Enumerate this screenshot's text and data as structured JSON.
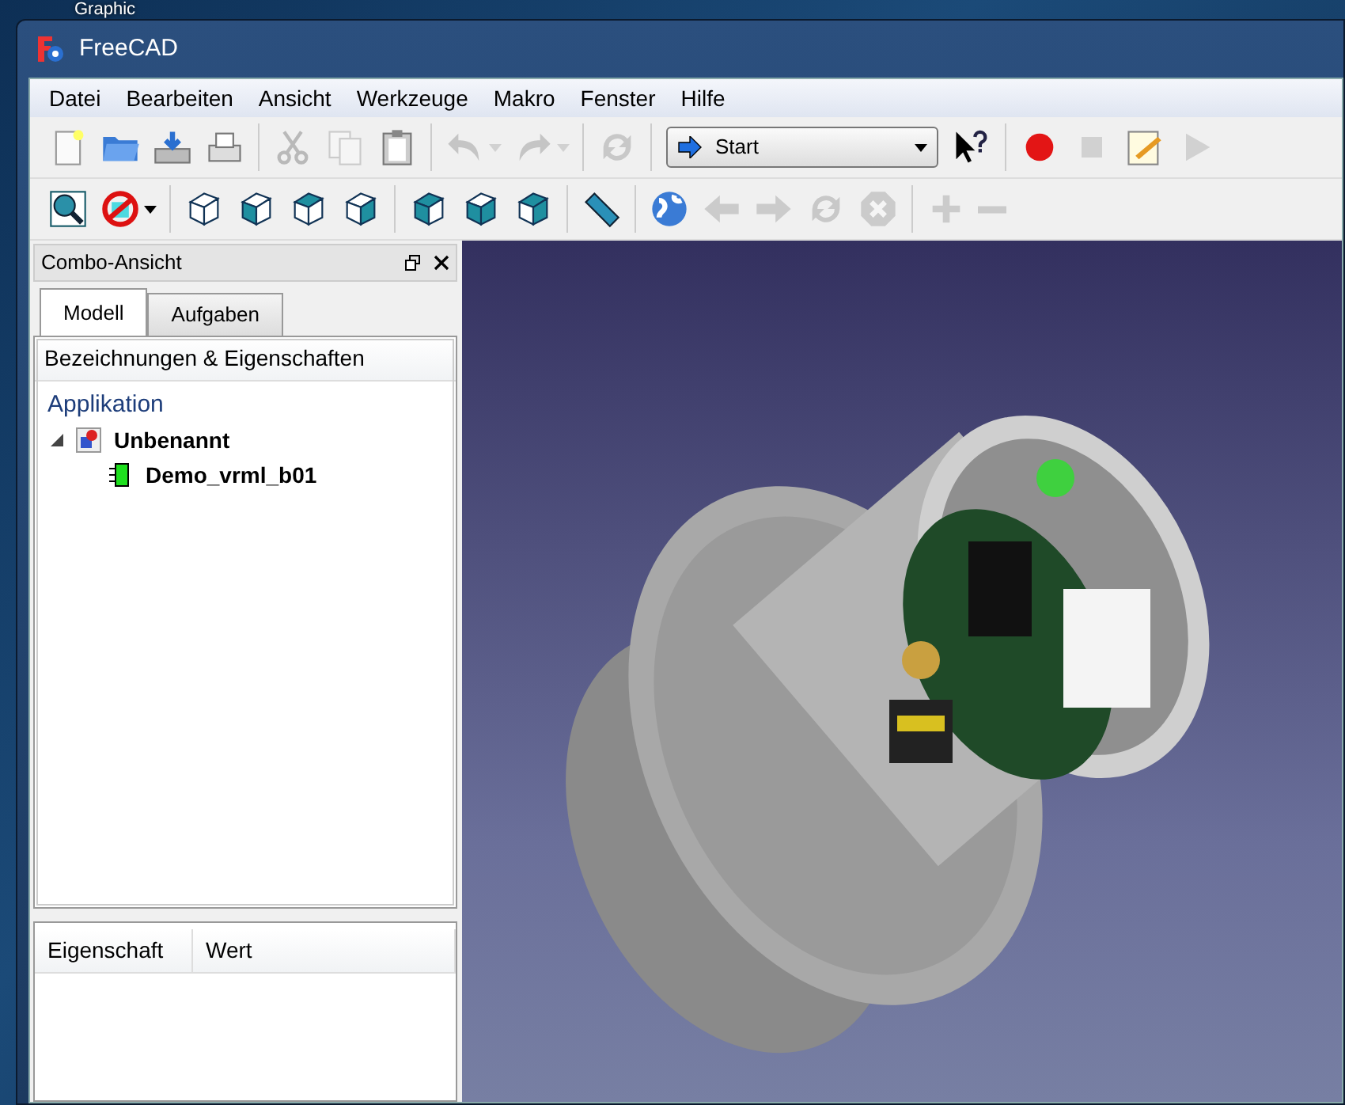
{
  "desktop": {
    "icon_label": "Graphic"
  },
  "window": {
    "title": "FreeCAD"
  },
  "menu": [
    "Datei",
    "Bearbeiten",
    "Ansicht",
    "Werkzeuge",
    "Makro",
    "Fenster",
    "Hilfe"
  ],
  "toolbars": [
    {
      "items": [
        {
          "kind": "new",
          "disabled": false
        },
        {
          "kind": "open",
          "disabled": false
        },
        {
          "kind": "save",
          "disabled": false
        },
        {
          "kind": "print",
          "disabled": false
        },
        {
          "kind": "separator"
        },
        {
          "kind": "cut",
          "disabled": true
        },
        {
          "kind": "copy",
          "disabled": true
        },
        {
          "kind": "paste",
          "disabled": false
        },
        {
          "kind": "separator"
        },
        {
          "kind": "undo",
          "disabled": true,
          "dropdown": true
        },
        {
          "kind": "redo",
          "disabled": true,
          "dropdown": true
        },
        {
          "kind": "separator"
        },
        {
          "kind": "refresh",
          "disabled": true
        },
        {
          "kind": "separator"
        },
        {
          "kind": "combo",
          "label": "Start"
        },
        {
          "kind": "whatsthis",
          "disabled": false
        },
        {
          "kind": "separator"
        },
        {
          "kind": "record",
          "disabled": false
        },
        {
          "kind": "stop",
          "disabled": true
        },
        {
          "kind": "edit",
          "disabled": false
        },
        {
          "kind": "play",
          "disabled": true
        }
      ]
    },
    {
      "items": [
        {
          "kind": "fit",
          "disabled": false
        },
        {
          "kind": "drawstyle",
          "disabled": false,
          "dropdown": true
        },
        {
          "kind": "separator"
        },
        {
          "kind": "iso",
          "disabled": false
        },
        {
          "kind": "front",
          "disabled": false
        },
        {
          "kind": "top",
          "disabled": false
        },
        {
          "kind": "right",
          "disabled": false
        },
        {
          "kind": "separator"
        },
        {
          "kind": "rear",
          "disabled": false
        },
        {
          "kind": "bottom",
          "disabled": false
        },
        {
          "kind": "left",
          "disabled": false
        },
        {
          "kind": "separator"
        },
        {
          "kind": "measure",
          "disabled": false
        },
        {
          "kind": "separator"
        },
        {
          "kind": "globe",
          "disabled": false
        },
        {
          "kind": "back",
          "disabled": true
        },
        {
          "kind": "forward",
          "disabled": true
        },
        {
          "kind": "refresh",
          "disabled": true
        },
        {
          "kind": "stopload",
          "disabled": true
        },
        {
          "kind": "separator"
        },
        {
          "kind": "zoomin",
          "disabled": true
        },
        {
          "kind": "zoomout",
          "disabled": true
        }
      ]
    }
  ],
  "dock": {
    "title": "Combo-Ansicht",
    "tabs": [
      {
        "label": "Modell",
        "selected": true
      },
      {
        "label": "Aufgaben",
        "selected": false
      }
    ],
    "tree_header": "Bezeichnungen & Eigenschaften",
    "tree_root": "Applikation",
    "tree": [
      {
        "label": "Unbenannt",
        "kind": "document",
        "expanded": true,
        "children": [
          {
            "label": "Demo_vrml_b01",
            "kind": "mesh"
          }
        ]
      }
    ],
    "property_columns": [
      "Eigenschaft",
      "Wert"
    ]
  }
}
